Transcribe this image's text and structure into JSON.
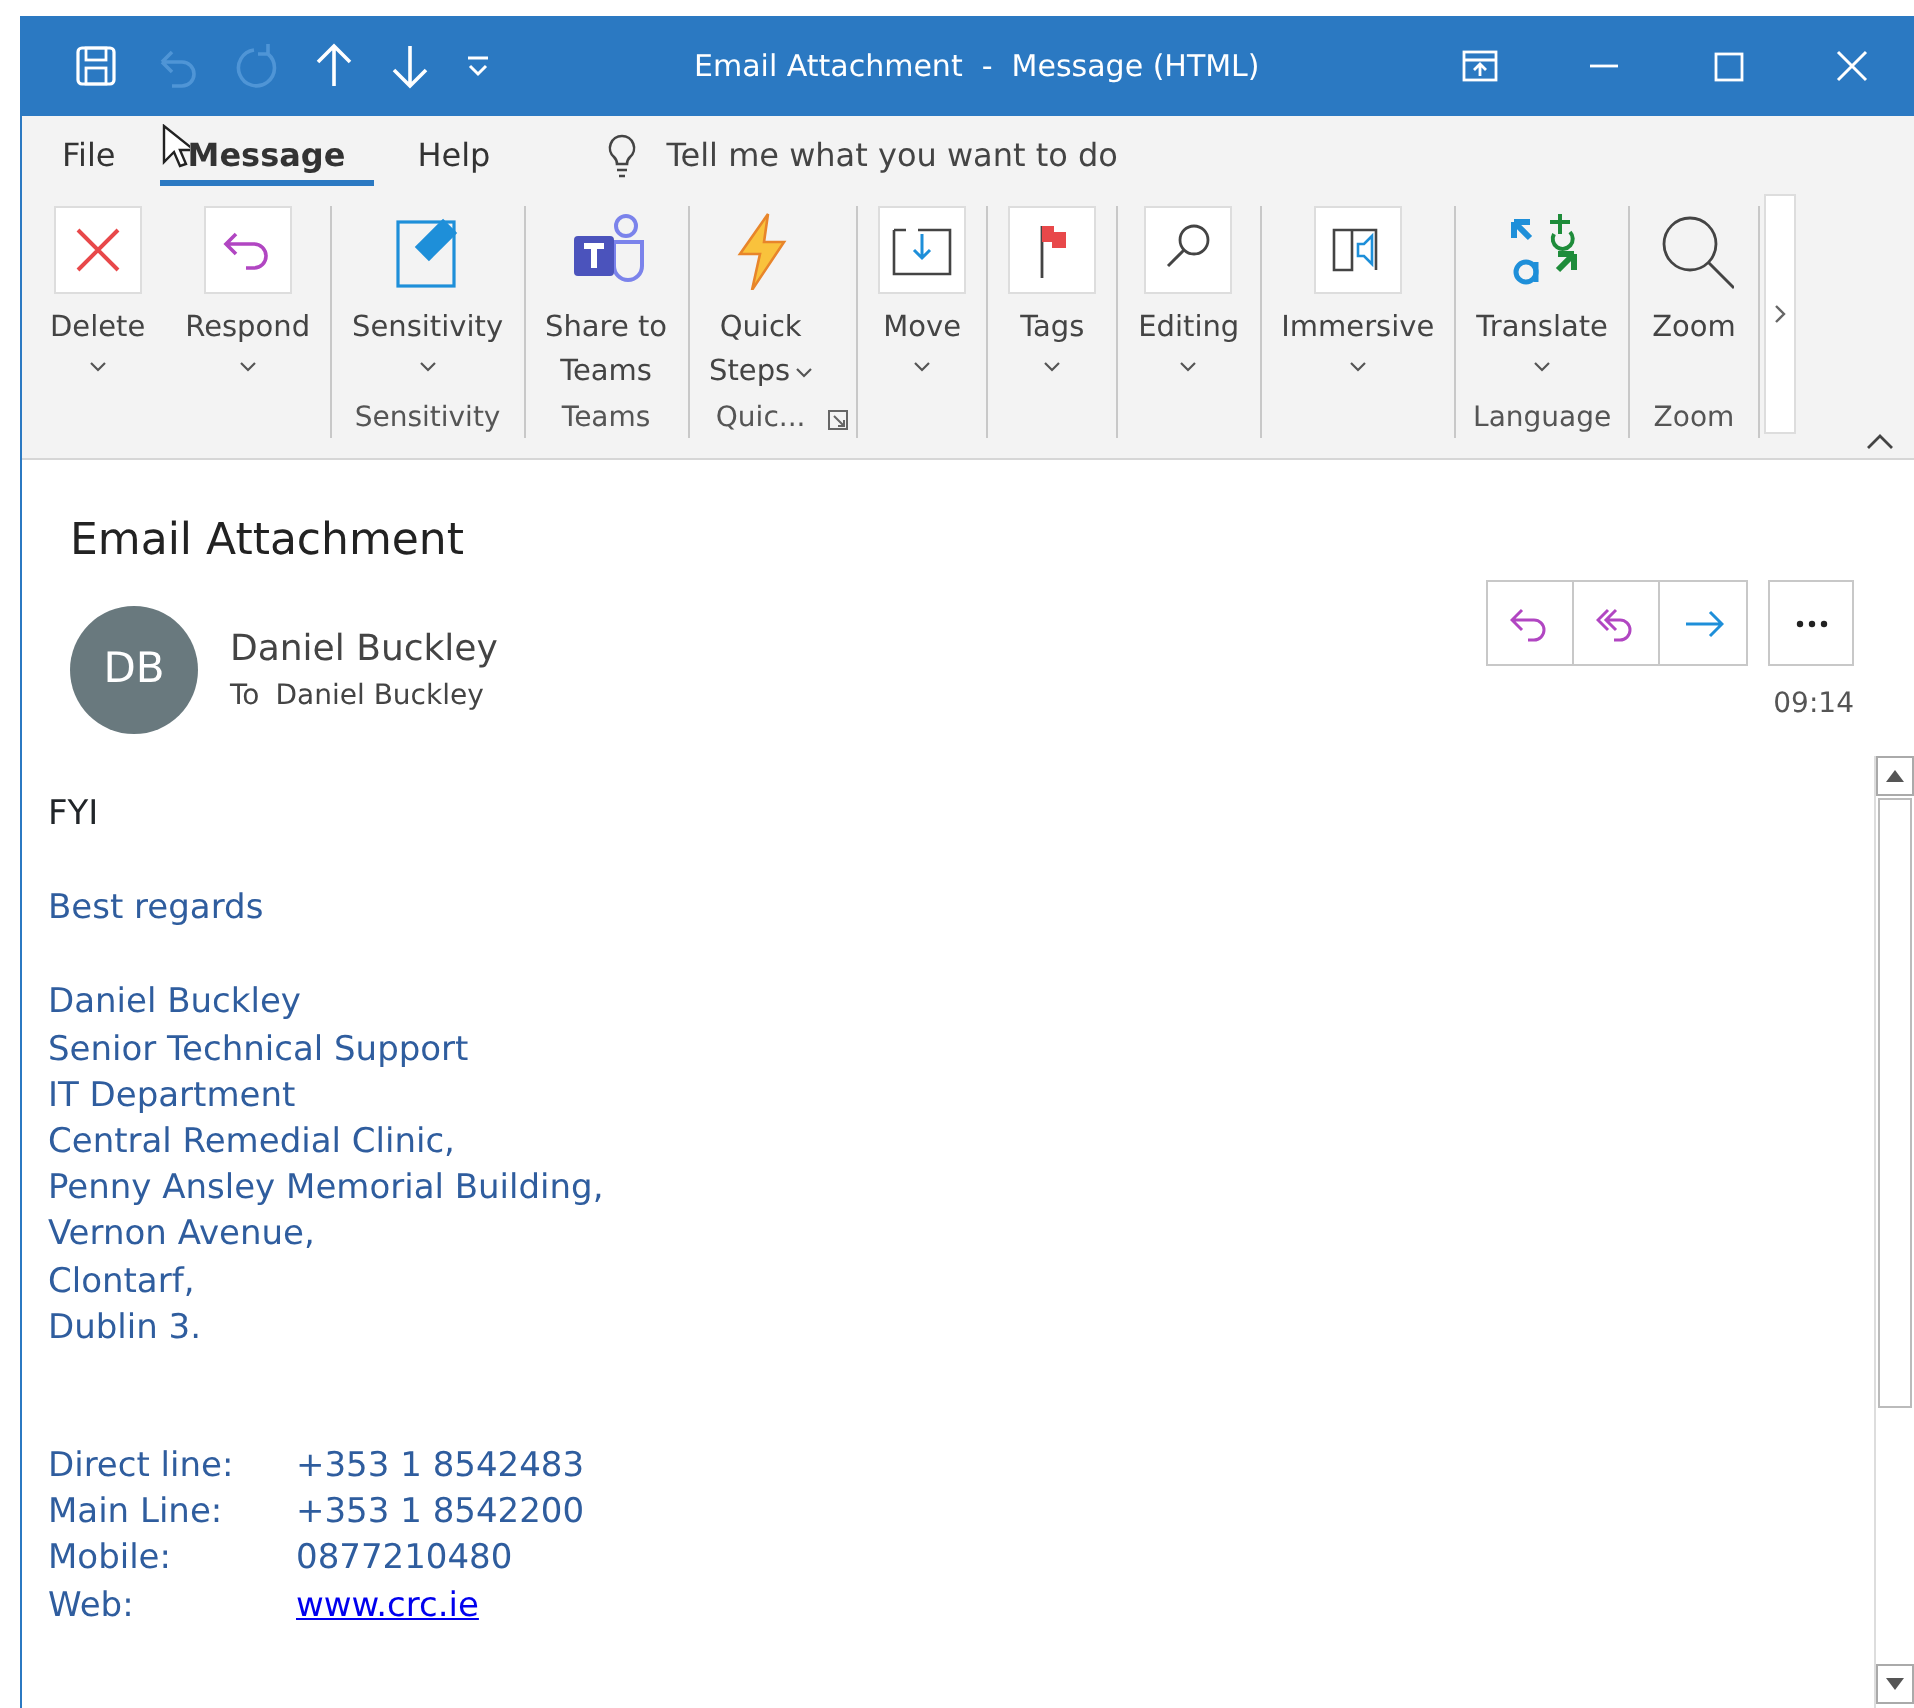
{
  "window": {
    "title": "Email Attachment  -  Message (HTML)"
  },
  "menu_tabs": [
    {
      "label": "File",
      "selected": false
    },
    {
      "label": "Message",
      "selected": true
    },
    {
      "label": "Help",
      "selected": false
    }
  ],
  "tell_me": {
    "placeholder": "Tell me what you want to do"
  },
  "ribbon": {
    "groups": [
      {
        "buttons": [
          {
            "lines": [
              "Delete"
            ],
            "dropdown": true
          },
          {
            "lines": [
              "Respond"
            ],
            "dropdown": true
          }
        ]
      },
      {
        "label": "Sensitivity",
        "buttons": [
          {
            "lines": [
              "Sensitivity"
            ],
            "dropdown": true
          }
        ]
      },
      {
        "label": "Teams",
        "buttons": [
          {
            "lines": [
              "Share to",
              "Teams"
            ],
            "dropdown": false
          }
        ]
      },
      {
        "label": "Quic...",
        "launcher": true,
        "buttons": [
          {
            "lines": [
              "Quick",
              "Steps"
            ],
            "dropdown": true
          }
        ]
      },
      {
        "buttons": [
          {
            "lines": [
              "Move"
            ],
            "dropdown": true
          }
        ]
      },
      {
        "buttons": [
          {
            "lines": [
              "Tags"
            ],
            "dropdown": true
          }
        ]
      },
      {
        "buttons": [
          {
            "lines": [
              "Editing"
            ],
            "dropdown": true
          }
        ]
      },
      {
        "buttons": [
          {
            "lines": [
              "Immersive"
            ],
            "dropdown": true
          }
        ]
      },
      {
        "label": "Language",
        "buttons": [
          {
            "lines": [
              "Translate"
            ],
            "dropdown": true
          }
        ]
      },
      {
        "label": "Zoom",
        "buttons": [
          {
            "lines": [
              "Zoom"
            ],
            "dropdown": false
          }
        ]
      }
    ]
  },
  "message": {
    "subject": "Email Attachment",
    "avatar_initials": "DB",
    "sender": "Daniel Buckley",
    "to_label": "To",
    "to": "Daniel Buckley",
    "time": "09:14"
  },
  "body": {
    "greeting": "FYI",
    "closing": "Best regards",
    "signature": [
      "Daniel Buckley",
      "Senior Technical Support",
      "IT Department",
      "Central Remedial Clinic,",
      "Penny Ansley Memorial Building,",
      "Vernon Avenue,",
      "Clontarf,",
      "Dublin 3."
    ],
    "contacts": [
      {
        "label": "Direct line:",
        "value": "+353 1 8542483",
        "kind": "text"
      },
      {
        "label": "Main Line:",
        "value": "+353 1 8542200",
        "kind": "text"
      },
      {
        "label": "Mobile:",
        "value": "0877210480",
        "kind": "text"
      },
      {
        "label": "Web:",
        "value": "www.crc.ie",
        "kind": "link"
      }
    ]
  }
}
